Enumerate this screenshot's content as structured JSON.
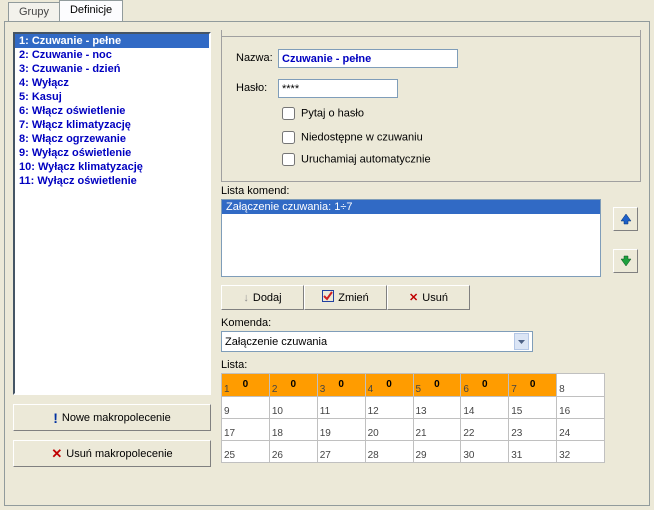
{
  "tabs": {
    "grupy": "Grupy",
    "definicje": "Definicje"
  },
  "definitions": [
    "1: Czuwanie - pełne",
    "2: Czuwanie - noc",
    "3: Czuwanie - dzień",
    "4: Wyłącz",
    "5: Kasuj",
    "6: Włącz oświetlenie",
    "7: Włącz klimatyzację",
    "8: Włącz ogrzewanie",
    "9: Wyłącz oświetlenie",
    "10: Wyłącz klimatyzację",
    "11: Wyłącz oświetlenie"
  ],
  "selected_def_index": 0,
  "form": {
    "name_label": "Nazwa:",
    "name_value": "Czuwanie - pełne",
    "pass_label": "Hasło:",
    "pass_value": "****",
    "chk_ask_pass": "Pytaj o hasło",
    "chk_unavailable": "Niedostępne w czuwaniu",
    "chk_autorun": "Uruchamiaj automatycznie"
  },
  "commands": {
    "list_label": "Lista komend:",
    "items": [
      "Załączenie czuwania: 1÷7"
    ],
    "selected_index": 0,
    "btn_add": "Dodaj",
    "btn_change": "Zmień",
    "btn_delete": "Usuń",
    "combo_label": "Komenda:",
    "combo_value": "Załączenie czuwania",
    "list2_label": "Lista:"
  },
  "grid": {
    "header_values": [
      "0",
      "0",
      "0",
      "0",
      "0",
      "0",
      "0",
      ""
    ],
    "header_nums": [
      "1",
      "2",
      "3",
      "4",
      "5",
      "6",
      "7",
      "8"
    ],
    "rows": [
      [
        "9",
        "10",
        "11",
        "12",
        "13",
        "14",
        "15",
        "16"
      ],
      [
        "17",
        "18",
        "19",
        "20",
        "21",
        "22",
        "23",
        "24"
      ],
      [
        "25",
        "26",
        "27",
        "28",
        "29",
        "30",
        "31",
        "32"
      ]
    ]
  },
  "left_btns": {
    "new": "Nowe makropolecenie",
    "del": "Usuń makropolecenie"
  }
}
